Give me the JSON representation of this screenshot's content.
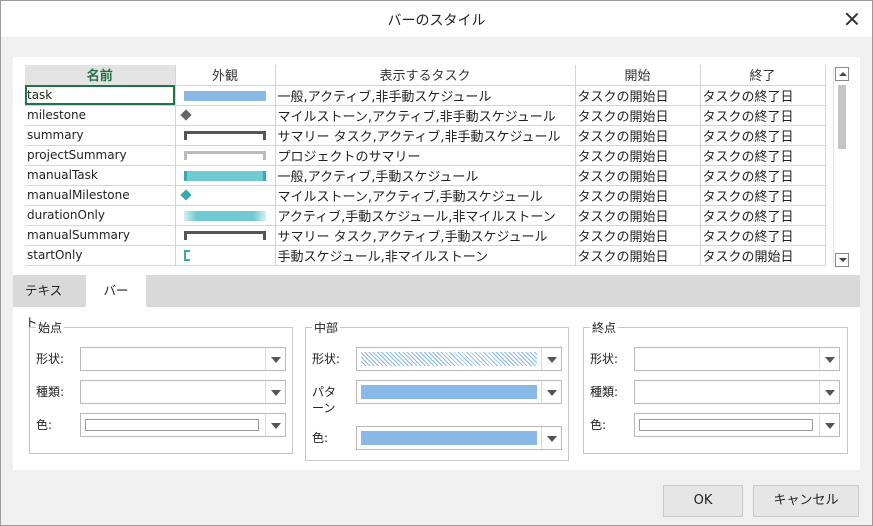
{
  "dialog": {
    "title": "バーのスタイル"
  },
  "grid": {
    "columns": [
      "名前",
      "外観",
      "表示するタスク",
      "開始",
      "終了"
    ],
    "rows": [
      {
        "name": "task",
        "tasks": "一般,アクティブ,非手動スケジュール",
        "start": "タスクの開始日",
        "end": "タスクの終了日",
        "look": "task-bar"
      },
      {
        "name": "milestone",
        "tasks": "マイルストーン,アクティブ,非手動スケジュール",
        "start": "タスクの開始日",
        "end": "タスクの終了日",
        "look": "milestone-diamond"
      },
      {
        "name": "summary",
        "tasks": "サマリー タスク,アクティブ,非手動スケジュール",
        "start": "タスクの開始日",
        "end": "タスクの終了日",
        "look": "summary-bracket"
      },
      {
        "name": "projectSummary",
        "tasks": "プロジェクトのサマリー",
        "start": "タスクの開始日",
        "end": "タスクの終了日",
        "look": "project-summary-bracket"
      },
      {
        "name": "manualTask",
        "tasks": "一般,アクティブ,手動スケジュール",
        "start": "タスクの開始日",
        "end": "タスクの終了日",
        "look": "manual-task-bar"
      },
      {
        "name": "manualMilestone",
        "tasks": "マイルストーン,アクティブ,手動スケジュール",
        "start": "タスクの開始日",
        "end": "タスクの終了日",
        "look": "manual-milestone-diamond"
      },
      {
        "name": "durationOnly",
        "tasks": "アクティブ,手動スケジュール,非マイルストーン",
        "start": "タスクの開始日",
        "end": "タスクの終了日",
        "look": "duration-only-bar"
      },
      {
        "name": "manualSummary",
        "tasks": "サマリー タスク,アクティブ,手動スケジュール",
        "start": "タスクの開始日",
        "end": "タスクの終了日",
        "look": "manual-summary-bracket"
      },
      {
        "name": "startOnly",
        "tasks": "手動スケジュール,非マイルストーン",
        "start": "タスクの開始日",
        "end": "タスクの開始日",
        "look": "start-only-bracket"
      }
    ]
  },
  "tabs": [
    {
      "label": "テキスト",
      "active": false
    },
    {
      "label": "バー",
      "active": true
    }
  ],
  "groups": {
    "start": {
      "title": "始点",
      "shape_label": "形状:",
      "type_label": "種類:",
      "color_label": "色:"
    },
    "middle": {
      "title": "中部",
      "shape_label": "形状:",
      "pattern_label": "パターン",
      "color_label": "色:"
    },
    "end": {
      "title": "終点",
      "shape_label": "形状:",
      "type_label": "種類:",
      "color_label": "色:"
    }
  },
  "colors": {
    "task_blue": "#8ab9e8",
    "manual_teal": "#6fcbd1",
    "milestone_gray": "#666666",
    "manual_milestone_teal": "#3aa9ae",
    "summary_dark": "#555555",
    "project_gray": "#bbbbbb",
    "accent_green": "#217346"
  },
  "buttons": {
    "ok": "OK",
    "cancel": "キャンセル"
  }
}
